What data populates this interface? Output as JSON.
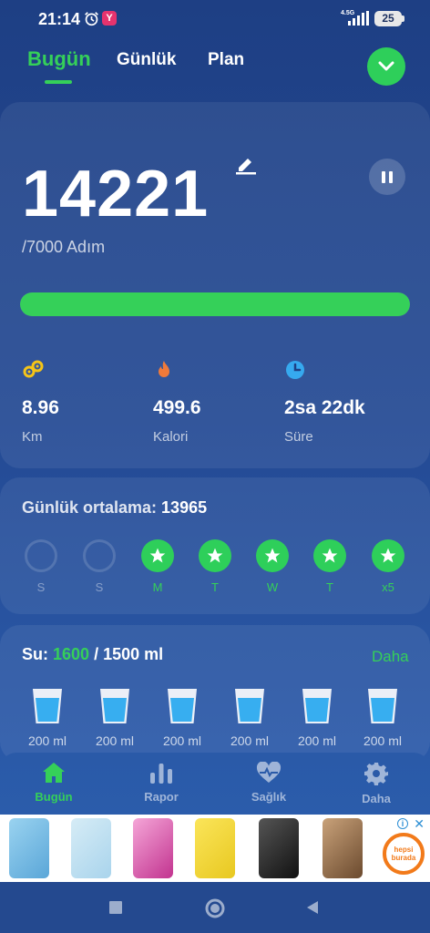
{
  "status_bar": {
    "time": "21:14",
    "network": "4.5G",
    "battery": "25",
    "app_badge": "Y"
  },
  "tabs": {
    "today": "Bugün",
    "daily": "Günlük",
    "plan": "Plan"
  },
  "steps": {
    "value": "14221",
    "goal_text": "/7000 Adım",
    "progress_fraction": 1.0,
    "stats": [
      {
        "icon": "distance-icon",
        "value": "8.96",
        "label": "Km",
        "color": "#f5c518"
      },
      {
        "icon": "flame-icon",
        "value": "499.6",
        "label": "Kalori",
        "color": "#f07a3a"
      },
      {
        "icon": "clock-icon",
        "value": "2sa 22dk",
        "label": "Süre",
        "color": "#36a9ef"
      }
    ]
  },
  "average": {
    "label": "Günlük ortalama:",
    "value": "13965",
    "days": [
      {
        "label": "S",
        "done": false
      },
      {
        "label": "S",
        "done": false
      },
      {
        "label": "M",
        "done": true
      },
      {
        "label": "T",
        "done": true
      },
      {
        "label": "W",
        "done": true
      },
      {
        "label": "T",
        "done": true
      },
      {
        "label": "x5",
        "done": true
      }
    ]
  },
  "water": {
    "label": "Su:",
    "current": "1600",
    "goal": "/ 1500 ml",
    "more": "Daha",
    "cups": [
      "200 ml",
      "200 ml",
      "200 ml",
      "200 ml",
      "200 ml",
      "200 ml"
    ]
  },
  "nav": {
    "today": "Bugün",
    "report": "Rapor",
    "health": "Sağlık",
    "more": "Daha"
  },
  "ad": {
    "shop_line1": "hepsi",
    "shop_line2": "burada"
  },
  "colors": {
    "accent": "#35d059",
    "background": "#244a94"
  }
}
